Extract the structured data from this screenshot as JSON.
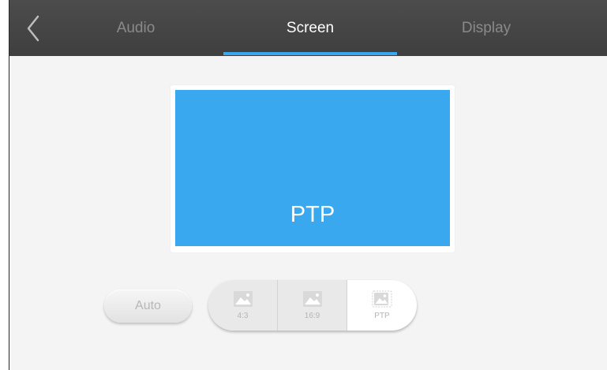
{
  "topbar": {
    "back_icon": "chevron-left-icon",
    "tabs": [
      {
        "label": "Audio",
        "active": false
      },
      {
        "label": "Screen",
        "active": true
      },
      {
        "label": "Display",
        "active": false
      }
    ],
    "accent_color": "#3aa8ec"
  },
  "preview": {
    "label": "PTP",
    "color": "#3aa8ee"
  },
  "controls": {
    "auto_label": "Auto",
    "aspect_options": [
      {
        "label": "4:3",
        "icon": "image-icon",
        "selected": false
      },
      {
        "label": "16:9",
        "icon": "image-icon",
        "selected": false
      },
      {
        "label": "PTP",
        "icon": "image-ptp-icon",
        "selected": true
      }
    ]
  }
}
